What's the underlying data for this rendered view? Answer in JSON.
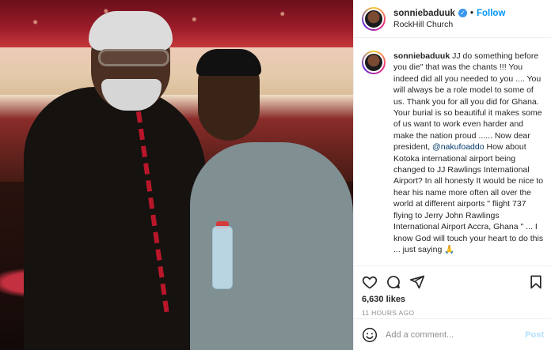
{
  "post": {
    "username": "sonniebaduuk",
    "verified": true,
    "follow_label": "Follow",
    "separator": "•",
    "location": "RockHill Church"
  },
  "caption": {
    "username": "sonniebaduuk",
    "text_before_mention": "JJ do something before you die\" that was the chants !!! You indeed did all you needed to you .... You will always be a role model to some of us. Thank you for all you did for Ghana. Your burial is so beautiful it makes some of us want to work even harder and make the nation proud ...... Now dear president, ",
    "mention": "@nakufoaddo",
    "text_after_mention": " How about Kotoka international airport being changed to JJ Rawlings International Airport? In all honesty It would be nice to hear his name more often all over the world at different airports \" flight 737 flying to Jerry John Rawlings International Airport Accra, Ghana \" ... I know God will touch your heart to do this ... just saying 🙏"
  },
  "stats": {
    "likes": "6,630 likes",
    "timestamp": "11 HOURS AGO"
  },
  "comment": {
    "placeholder": "Add a comment...",
    "post_label": "Post"
  },
  "icons": {
    "like": "heart-icon",
    "comment": "comment-icon",
    "share": "share-icon",
    "save": "bookmark-icon",
    "emoji": "emoji-icon"
  },
  "colors": {
    "accent": "#0095f6",
    "verified": "#3897f0",
    "post_disabled": "#b2dffc",
    "muted": "#8e8e8e"
  }
}
